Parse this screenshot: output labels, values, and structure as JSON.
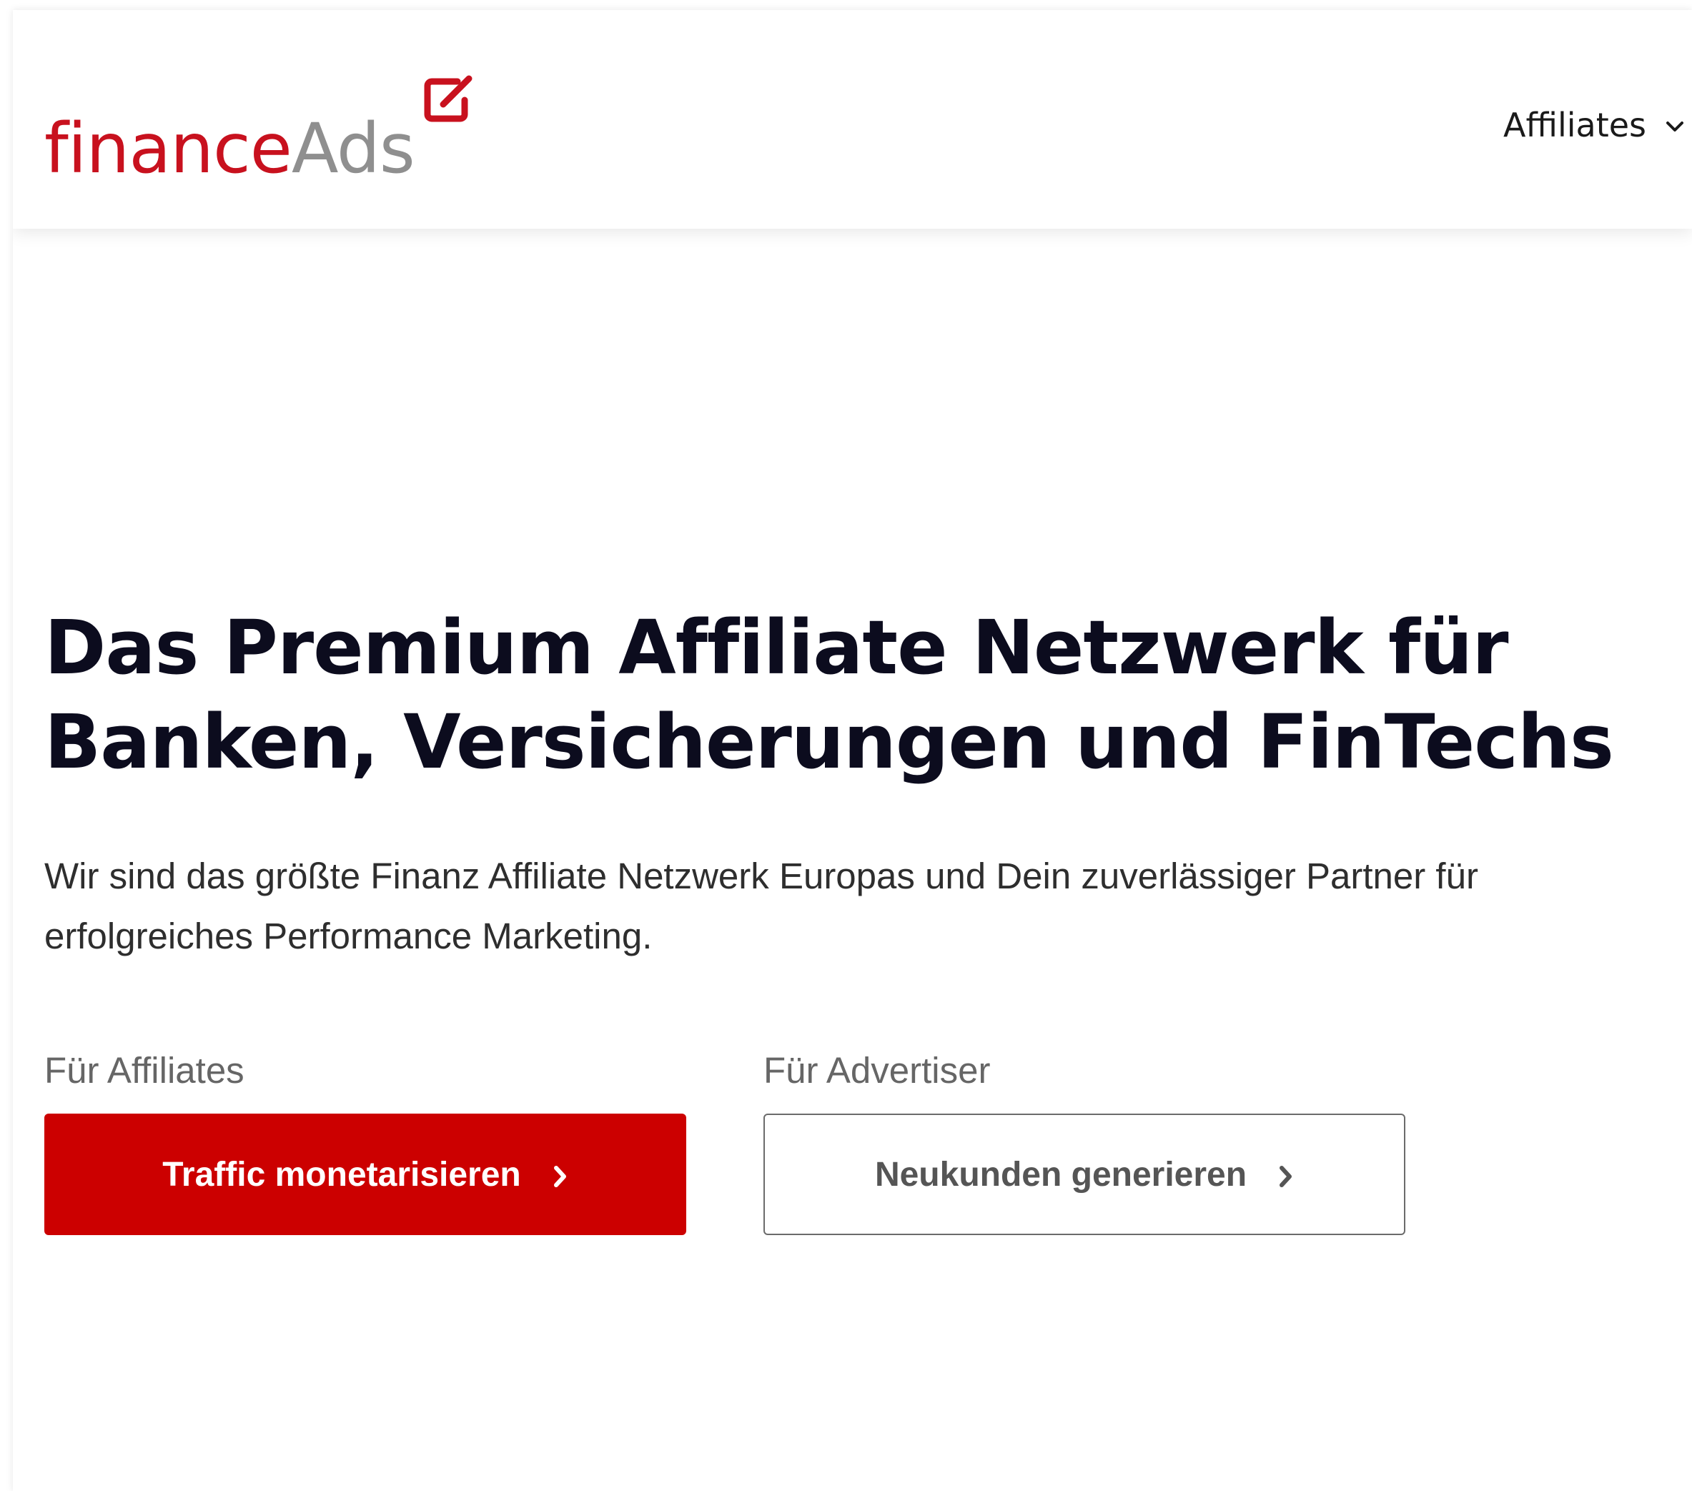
{
  "brand": {
    "name_part1": "finance",
    "name_part2": "Ads",
    "primary_color": "#c8111e",
    "secondary_color": "#8f8f8f",
    "icon": "edit-checkbox-icon"
  },
  "nav": {
    "affiliates_label": "Affiliates",
    "affiliates_icon": "chevron-down-icon"
  },
  "hero": {
    "headline": "Das Premium Affiliate Netzwerk für Banken, Versicherungen und FinTechs",
    "lead": "Wir sind das größte Finanz Affiliate Netzwerk Europas und Dein zuverlässiger Partner für erfolgreiches Performance Marketing."
  },
  "cta": {
    "affiliates": {
      "label": "Für Affiliates",
      "button": "Traffic monetarisieren",
      "icon": "chevron-right-icon",
      "color": "#cc0000"
    },
    "advertiser": {
      "label": "Für Advertiser",
      "button": "Neukunden generieren",
      "icon": "chevron-right-icon"
    }
  }
}
